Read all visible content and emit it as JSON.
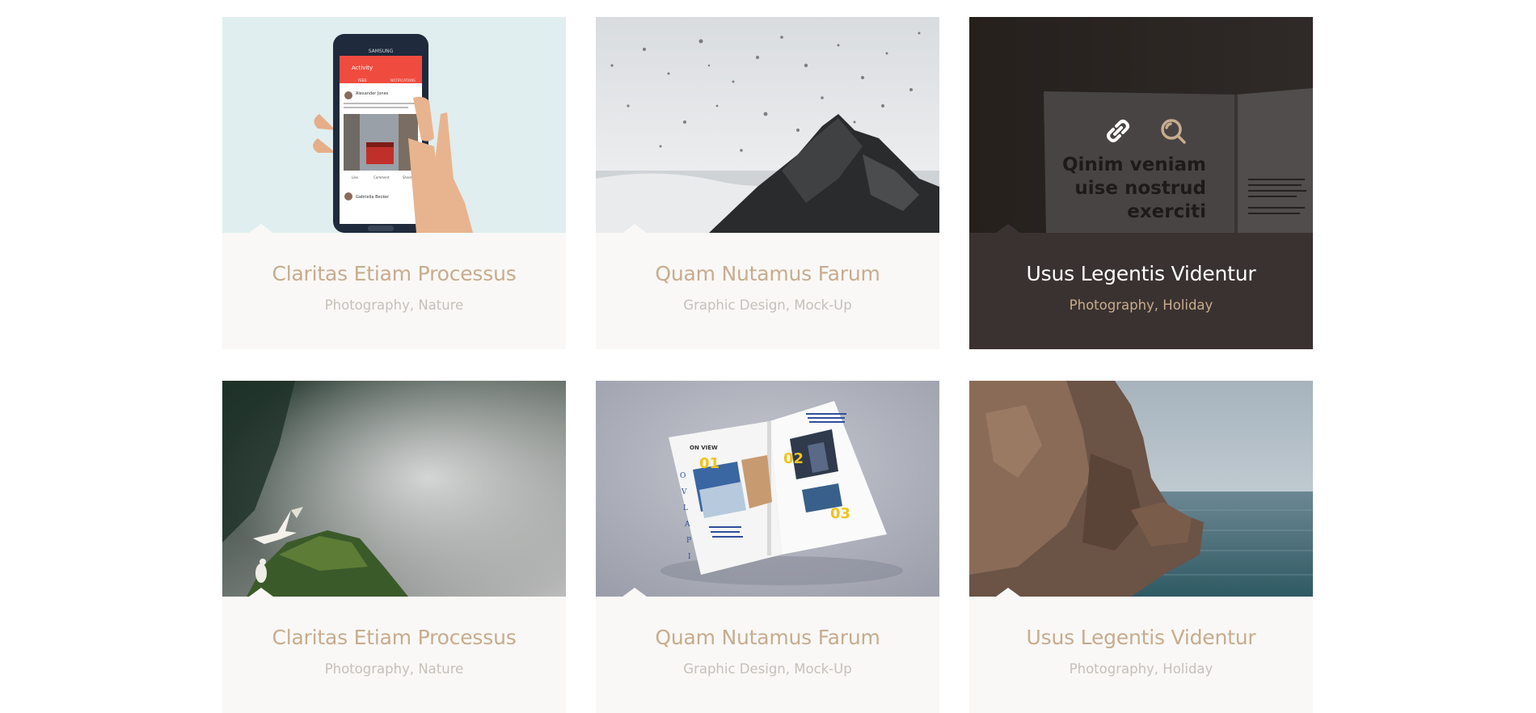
{
  "portfolio": {
    "items": [
      {
        "title": "Claritas Etiam Processus",
        "categories": "Photography, Nature",
        "image": "phone-in-hand-mockup",
        "active": false
      },
      {
        "title": "Quam Nutamus Farum",
        "categories": "Graphic Design, Mock-Up",
        "image": "waves-crashing-on-rock",
        "active": false
      },
      {
        "title": "Usus Legentis Videntur",
        "categories": "Photography, Holiday",
        "image": "open-book-mockup",
        "active": true,
        "overlay": {
          "icons": [
            "link-icon",
            "zoom-icon"
          ]
        }
      },
      {
        "title": "Claritas Etiam Processus",
        "categories": "Photography, Nature",
        "image": "seagulls-on-mossy-cliff",
        "active": false
      },
      {
        "title": "Quam Nutamus Farum",
        "categories": "Graphic Design, Mock-Up",
        "image": "magazine-mockup",
        "active": false
      },
      {
        "title": "Usus Legentis Videntur",
        "categories": "Photography, Holiday",
        "image": "sea-rocks",
        "active": false
      }
    ]
  },
  "images": {
    "phone": {
      "brand": "SAMSUNG",
      "app_title": "Activity",
      "tabs": [
        "FEED",
        "NOTIFICATIONS"
      ],
      "user_name": "Alexander Jones",
      "user_name_2": "Gabriella Becker",
      "actions": [
        "Like",
        "Comment",
        "Share"
      ]
    },
    "book": {
      "lines": [
        "Qinim veniam",
        "uise nostrud",
        "exerciti"
      ]
    },
    "magazine": {
      "heading": "ON VIEW",
      "numbers": [
        "01",
        "02",
        "03"
      ]
    }
  },
  "colors": {
    "accent": "#c7ac8e",
    "caption_bg": "#f9f8f6",
    "active_bg": "#3a3230",
    "muted_text": "#c6c0ba"
  }
}
